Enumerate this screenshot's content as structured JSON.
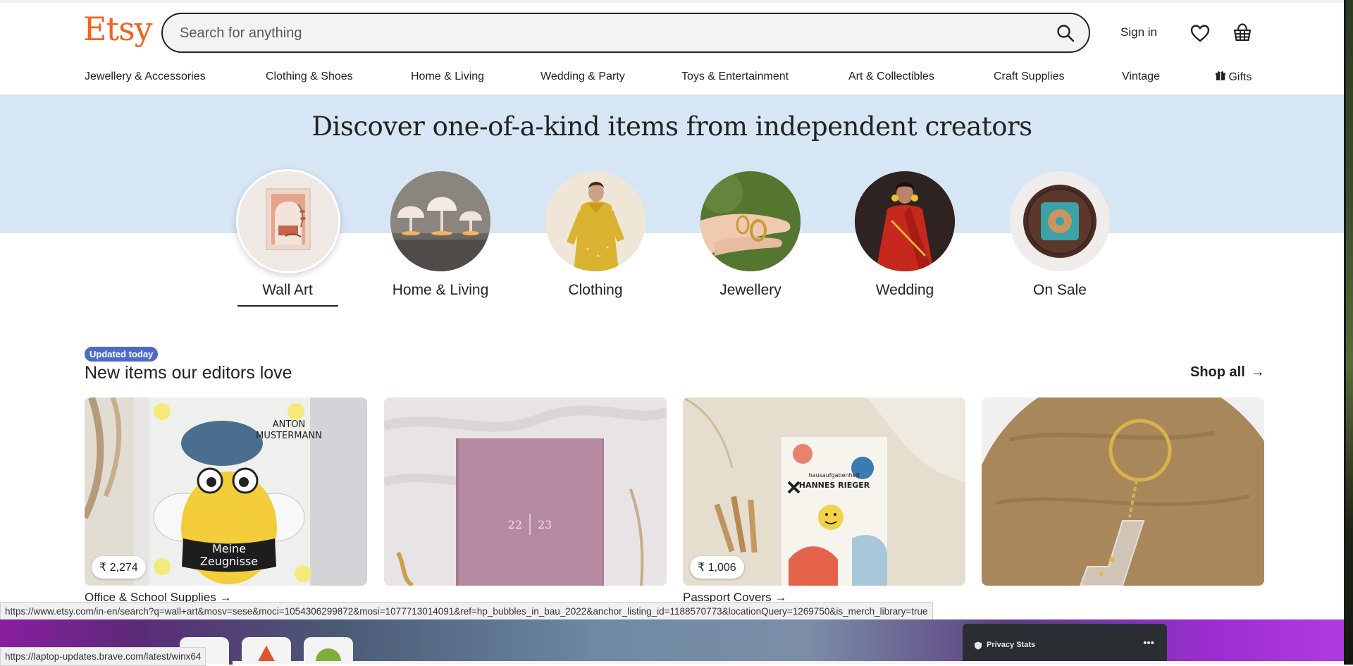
{
  "header": {
    "logo": "Etsy",
    "search_placeholder": "Search for anything",
    "sign_in": "Sign in"
  },
  "nav": {
    "items": [
      "Jewellery & Accessories",
      "Clothing & Shoes",
      "Home & Living",
      "Wedding & Party",
      "Toys & Entertainment",
      "Art & Collectibles",
      "Craft Supplies",
      "Vintage",
      "Gifts"
    ]
  },
  "hero": {
    "title": "Discover one-of-a-kind items from independent creators",
    "bubbles": [
      {
        "label": "Wall Art",
        "selected": true
      },
      {
        "label": "Home & Living"
      },
      {
        "label": "Clothing"
      },
      {
        "label": "Jewellery"
      },
      {
        "label": "Wedding"
      },
      {
        "label": "On Sale"
      }
    ]
  },
  "editors": {
    "badge": "Updated today",
    "title": "New items our editors love",
    "shop_all": "Shop all",
    "cards": [
      {
        "price": "₹ 2,274",
        "caption": "Office & School Supplies",
        "art_text": [
          "ANTON",
          "MUSTERMANN",
          "Meine",
          "Zeugnisse"
        ]
      },
      {
        "price": "",
        "caption": "",
        "art_text": [
          "22",
          "23"
        ]
      },
      {
        "price": "₹ 1,006",
        "caption": "Passport Covers",
        "art_text": [
          "hausaufgabenheft",
          "HANNES RIEGER"
        ]
      },
      {
        "price": "",
        "caption": "",
        "art_text": []
      }
    ]
  },
  "status": {
    "link_url": "https://www.etsy.com/in-en/search?q=wall+art&mosv=sese&moci=1054306299872&mosi=1077713014091&ref=hp_bubbles_in_bau_2022&anchor_listing_id=1188570773&locationQuery=1269750&is_merch_library=true",
    "update_url": "https://laptop-updates.brave.com/latest/winx64"
  },
  "desktop": {
    "privacy_stats": "Privacy Stats",
    "menu_dots": "•••"
  },
  "colors": {
    "brand": "#f1641e",
    "hero_bg": "#d7e6f5",
    "badge_bg": "#4d6bc6"
  }
}
